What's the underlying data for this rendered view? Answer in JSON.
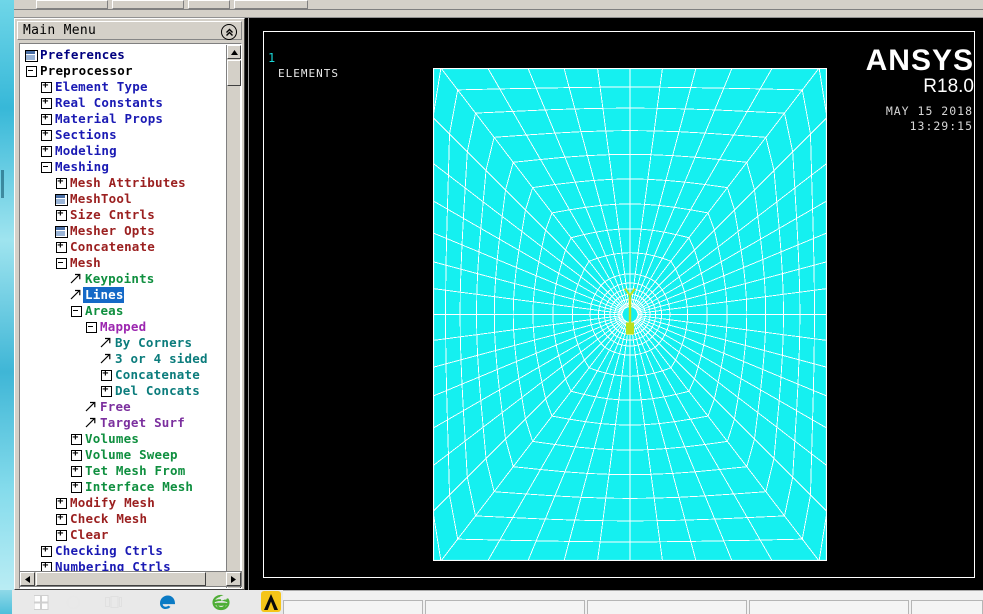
{
  "window": {
    "menu_panel_title": "Main Menu",
    "collapse_icon": "double-chevron-up-icon"
  },
  "tree": {
    "items": [
      {
        "label": "Preferences",
        "indent": 0,
        "icon": "window-icon",
        "color": "#000080",
        "selected": false
      },
      {
        "label": "Preprocessor",
        "indent": 0,
        "icon": "minus-box-icon",
        "color": "#000000",
        "selected": false
      },
      {
        "label": "Element Type",
        "indent": 1,
        "icon": "plus-box-icon",
        "color": "#1a1ab4",
        "selected": false
      },
      {
        "label": "Real Constants",
        "indent": 1,
        "icon": "plus-box-icon",
        "color": "#1a1ab4",
        "selected": false
      },
      {
        "label": "Material Props",
        "indent": 1,
        "icon": "plus-box-icon",
        "color": "#1a1ab4",
        "selected": false
      },
      {
        "label": "Sections",
        "indent": 1,
        "icon": "plus-box-icon",
        "color": "#1a1ab4",
        "selected": false
      },
      {
        "label": "Modeling",
        "indent": 1,
        "icon": "plus-box-icon",
        "color": "#1a1ab4",
        "selected": false
      },
      {
        "label": "Meshing",
        "indent": 1,
        "icon": "minus-box-icon",
        "color": "#1a1ab4",
        "selected": false
      },
      {
        "label": "Mesh Attributes",
        "indent": 2,
        "icon": "plus-box-icon",
        "color": "#9b2020",
        "selected": false
      },
      {
        "label": "MeshTool",
        "indent": 2,
        "icon": "window-icon",
        "color": "#9b2020",
        "selected": false
      },
      {
        "label": "Size Cntrls",
        "indent": 2,
        "icon": "plus-box-icon",
        "color": "#9b2020",
        "selected": false
      },
      {
        "label": "Mesher Opts",
        "indent": 2,
        "icon": "window-icon",
        "color": "#9b2020",
        "selected": false
      },
      {
        "label": "Concatenate",
        "indent": 2,
        "icon": "plus-box-icon",
        "color": "#9b2020",
        "selected": false
      },
      {
        "label": "Mesh",
        "indent": 2,
        "icon": "minus-box-icon",
        "color": "#9b2020",
        "selected": false
      },
      {
        "label": "Keypoints",
        "indent": 3,
        "icon": "arrow-icon",
        "color": "#0f8f3f",
        "selected": false
      },
      {
        "label": "Lines",
        "indent": 3,
        "icon": "arrow-icon",
        "color": "#0f8f3f",
        "selected": true
      },
      {
        "label": "Areas",
        "indent": 3,
        "icon": "minus-box-icon",
        "color": "#0f8f3f",
        "selected": false
      },
      {
        "label": "Mapped",
        "indent": 4,
        "icon": "minus-box-icon",
        "color": "#9c27b0",
        "selected": false
      },
      {
        "label": "By Corners",
        "indent": 5,
        "icon": "arrow-icon",
        "color": "#0b7c7c",
        "selected": false
      },
      {
        "label": "3 or 4 sided",
        "indent": 5,
        "icon": "arrow-icon",
        "color": "#0b7c7c",
        "selected": false
      },
      {
        "label": "Concatenate",
        "indent": 5,
        "icon": "plus-box-icon",
        "color": "#0b7c7c",
        "selected": false
      },
      {
        "label": "Del Concats",
        "indent": 5,
        "icon": "plus-box-icon",
        "color": "#0b7c7c",
        "selected": false
      },
      {
        "label": "Free",
        "indent": 4,
        "icon": "arrow-icon",
        "color": "#7b2f9e",
        "selected": false
      },
      {
        "label": "Target Surf",
        "indent": 4,
        "icon": "arrow-icon",
        "color": "#7b2f9e",
        "selected": false
      },
      {
        "label": "Volumes",
        "indent": 3,
        "icon": "plus-box-icon",
        "color": "#0f8f3f",
        "selected": false
      },
      {
        "label": "Volume Sweep",
        "indent": 3,
        "icon": "plus-box-icon",
        "color": "#0f8f3f",
        "selected": false
      },
      {
        "label": "Tet Mesh From",
        "indent": 3,
        "icon": "plus-box-icon",
        "color": "#0f8f3f",
        "selected": false
      },
      {
        "label": "Interface Mesh",
        "indent": 3,
        "icon": "plus-box-icon",
        "color": "#0f8f3f",
        "selected": false
      },
      {
        "label": "Modify Mesh",
        "indent": 2,
        "icon": "plus-box-icon",
        "color": "#9b2020",
        "selected": false
      },
      {
        "label": "Check Mesh",
        "indent": 2,
        "icon": "plus-box-icon",
        "color": "#9b2020",
        "selected": false
      },
      {
        "label": "Clear",
        "indent": 2,
        "icon": "plus-box-icon",
        "color": "#9b2020",
        "selected": false
      },
      {
        "label": "Checking Ctrls",
        "indent": 1,
        "icon": "plus-box-icon",
        "color": "#1a1ab4",
        "selected": false
      },
      {
        "label": "Numbering Ctrls",
        "indent": 1,
        "icon": "plus-box-icon",
        "color": "#1a1ab4",
        "selected": false
      }
    ]
  },
  "graphics": {
    "window_number": "1",
    "plot_title": "ELEMENTS",
    "brand": "ANSYS",
    "release": "R18.0",
    "date": "MAY 15 2018",
    "time": "13:29:15",
    "mesh_color": "#15f0f0",
    "mesh_line_color": "#ffffff",
    "triad_color": "#b9e020",
    "background": "#000000"
  },
  "taskbar": {
    "items": [
      {
        "name": "start-button",
        "icon": "windows-logo-icon"
      },
      {
        "name": "cortana-search",
        "icon": "circle-icon"
      },
      {
        "name": "task-view",
        "icon": "task-view-icon"
      },
      {
        "name": "edge-browser",
        "icon": "edge-icon"
      },
      {
        "name": "internet-explorer",
        "icon": "ie-icon"
      },
      {
        "name": "ansys-app",
        "icon": "ansys-icon"
      }
    ]
  }
}
